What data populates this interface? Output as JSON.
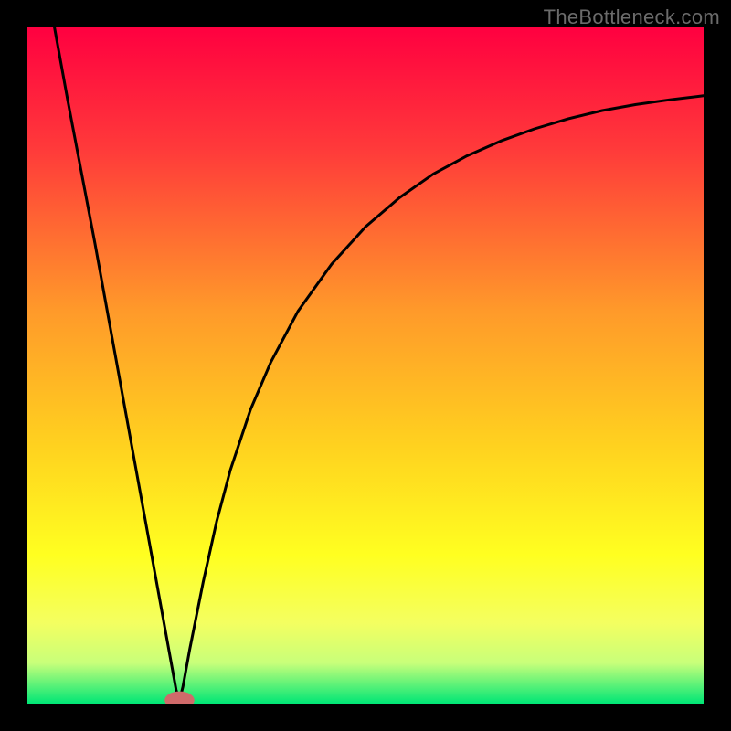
{
  "watermark": "TheBottleneck.com",
  "chart_data": {
    "type": "line",
    "title": "",
    "xlabel": "",
    "ylabel": "",
    "xlim": [
      0,
      100
    ],
    "ylim": [
      0,
      100
    ],
    "grid": false,
    "legend": false,
    "gradient_stops": [
      {
        "offset": 0,
        "color": "#ff0040"
      },
      {
        "offset": 18,
        "color": "#ff3a3a"
      },
      {
        "offset": 42,
        "color": "#ff9a2a"
      },
      {
        "offset": 62,
        "color": "#ffd21f"
      },
      {
        "offset": 78,
        "color": "#ffff20"
      },
      {
        "offset": 88,
        "color": "#f4ff60"
      },
      {
        "offset": 94,
        "color": "#c8ff7a"
      },
      {
        "offset": 100,
        "color": "#00e676"
      }
    ],
    "marker": {
      "x": 22.5,
      "y": 0.5,
      "color": "#d06a6a",
      "rx": 2.2,
      "ry": 1.3
    },
    "series": [
      {
        "name": "curve",
        "x": [
          4,
          6,
          8,
          10,
          12,
          14,
          16,
          18,
          20,
          21,
          22,
          22.5,
          23,
          24,
          25,
          26,
          28,
          30,
          33,
          36,
          40,
          45,
          50,
          55,
          60,
          65,
          70,
          75,
          80,
          85,
          90,
          95,
          100
        ],
        "y": [
          100,
          89,
          78.5,
          68,
          57,
          46,
          35,
          24,
          13,
          7.5,
          2,
          0.5,
          2.5,
          8,
          13,
          18,
          27,
          34.5,
          43.5,
          50.5,
          58,
          65,
          70.5,
          74.8,
          78.3,
          81,
          83.2,
          85,
          86.5,
          87.7,
          88.6,
          89.3,
          89.9
        ]
      }
    ]
  }
}
